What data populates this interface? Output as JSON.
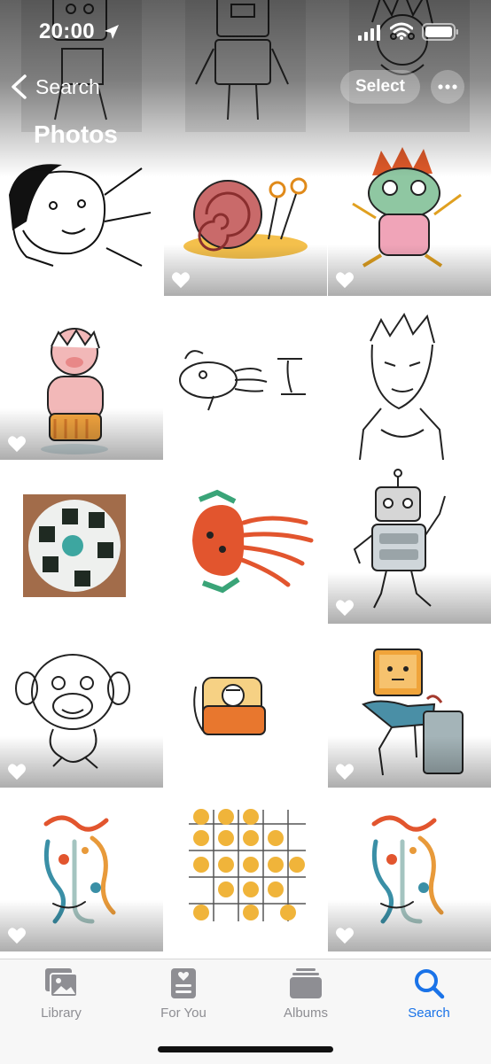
{
  "status_bar": {
    "time": "20:00"
  },
  "nav": {
    "back_label": "Search",
    "select_label": "Select",
    "title": "Photos"
  },
  "tabs": [
    {
      "label": "Library",
      "icon": "photo-stack-icon",
      "active": false
    },
    {
      "label": "For You",
      "icon": "for-you-icon",
      "active": false
    },
    {
      "label": "Albums",
      "icon": "albums-icon",
      "active": false
    },
    {
      "label": "Search",
      "icon": "magnifier-icon",
      "active": true
    }
  ],
  "photos": [
    {
      "subject": "robot sketch (partial)",
      "favorite": false
    },
    {
      "subject": "robot sketch",
      "favorite": false
    },
    {
      "subject": "spiky hair boy sketch",
      "favorite": false
    },
    {
      "subject": "man portrait sketch",
      "favorite": false
    },
    {
      "subject": "snail drawing",
      "favorite": true
    },
    {
      "subject": "frog monster drawing",
      "favorite": true
    },
    {
      "subject": "pig character",
      "favorite": true
    },
    {
      "subject": "fish sketch",
      "favorite": false
    },
    {
      "subject": "muscular man sketch",
      "favorite": false
    },
    {
      "subject": "rice ball plate photo",
      "favorite": false
    },
    {
      "subject": "jellyfish drawing",
      "favorite": false
    },
    {
      "subject": "robot drawing",
      "favorite": true
    },
    {
      "subject": "monkey sketch",
      "favorite": true
    },
    {
      "subject": "ring box drawing",
      "favorite": false
    },
    {
      "subject": "tv head character",
      "favorite": true
    },
    {
      "subject": "abstract figure",
      "favorite": true
    },
    {
      "subject": "dots grid drawing",
      "favorite": false
    },
    {
      "subject": "abstract figure",
      "favorite": true
    }
  ],
  "colors": {
    "accent": "#1a73e8",
    "tab_inactive": "#8e8e93"
  }
}
